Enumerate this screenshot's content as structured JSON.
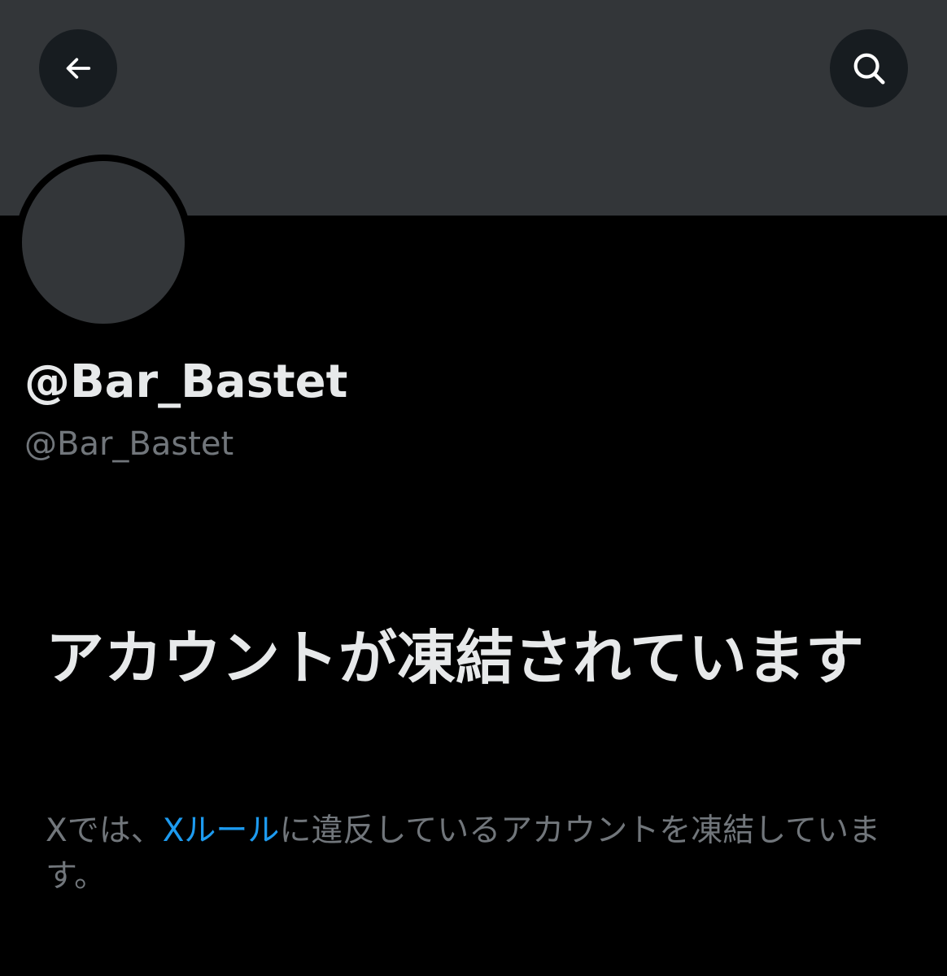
{
  "header": {
    "back_icon": "arrow-left-icon",
    "search_icon": "search-icon"
  },
  "profile": {
    "display_name": "@Bar_Bastet",
    "handle": "@Bar_Bastet"
  },
  "notice": {
    "title": "アカウントが凍結されています",
    "description_before": "Xでは、",
    "rules_link": "Xルール",
    "description_after": "に違反しているアカウントを凍結しています。"
  },
  "colors": {
    "background": "#000000",
    "banner": "#333639",
    "primary_text": "#e7e9ea",
    "secondary_text": "#71767b",
    "link": "#1d9bf0"
  }
}
